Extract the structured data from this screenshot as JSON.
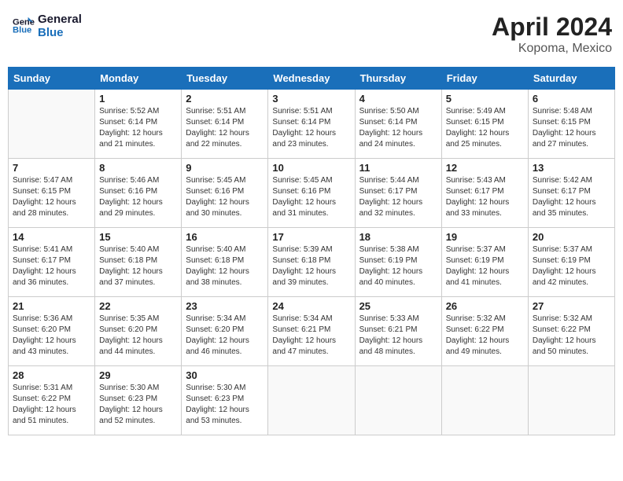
{
  "header": {
    "logo_line1": "General",
    "logo_line2": "Blue",
    "month_year": "April 2024",
    "location": "Kopoma, Mexico"
  },
  "weekdays": [
    "Sunday",
    "Monday",
    "Tuesday",
    "Wednesday",
    "Thursday",
    "Friday",
    "Saturday"
  ],
  "weeks": [
    [
      {
        "day": "",
        "info": ""
      },
      {
        "day": "1",
        "info": "Sunrise: 5:52 AM\nSunset: 6:14 PM\nDaylight: 12 hours\nand 21 minutes."
      },
      {
        "day": "2",
        "info": "Sunrise: 5:51 AM\nSunset: 6:14 PM\nDaylight: 12 hours\nand 22 minutes."
      },
      {
        "day": "3",
        "info": "Sunrise: 5:51 AM\nSunset: 6:14 PM\nDaylight: 12 hours\nand 23 minutes."
      },
      {
        "day": "4",
        "info": "Sunrise: 5:50 AM\nSunset: 6:14 PM\nDaylight: 12 hours\nand 24 minutes."
      },
      {
        "day": "5",
        "info": "Sunrise: 5:49 AM\nSunset: 6:15 PM\nDaylight: 12 hours\nand 25 minutes."
      },
      {
        "day": "6",
        "info": "Sunrise: 5:48 AM\nSunset: 6:15 PM\nDaylight: 12 hours\nand 27 minutes."
      }
    ],
    [
      {
        "day": "7",
        "info": "Sunrise: 5:47 AM\nSunset: 6:15 PM\nDaylight: 12 hours\nand 28 minutes."
      },
      {
        "day": "8",
        "info": "Sunrise: 5:46 AM\nSunset: 6:16 PM\nDaylight: 12 hours\nand 29 minutes."
      },
      {
        "day": "9",
        "info": "Sunrise: 5:45 AM\nSunset: 6:16 PM\nDaylight: 12 hours\nand 30 minutes."
      },
      {
        "day": "10",
        "info": "Sunrise: 5:45 AM\nSunset: 6:16 PM\nDaylight: 12 hours\nand 31 minutes."
      },
      {
        "day": "11",
        "info": "Sunrise: 5:44 AM\nSunset: 6:17 PM\nDaylight: 12 hours\nand 32 minutes."
      },
      {
        "day": "12",
        "info": "Sunrise: 5:43 AM\nSunset: 6:17 PM\nDaylight: 12 hours\nand 33 minutes."
      },
      {
        "day": "13",
        "info": "Sunrise: 5:42 AM\nSunset: 6:17 PM\nDaylight: 12 hours\nand 35 minutes."
      }
    ],
    [
      {
        "day": "14",
        "info": "Sunrise: 5:41 AM\nSunset: 6:17 PM\nDaylight: 12 hours\nand 36 minutes."
      },
      {
        "day": "15",
        "info": "Sunrise: 5:40 AM\nSunset: 6:18 PM\nDaylight: 12 hours\nand 37 minutes."
      },
      {
        "day": "16",
        "info": "Sunrise: 5:40 AM\nSunset: 6:18 PM\nDaylight: 12 hours\nand 38 minutes."
      },
      {
        "day": "17",
        "info": "Sunrise: 5:39 AM\nSunset: 6:18 PM\nDaylight: 12 hours\nand 39 minutes."
      },
      {
        "day": "18",
        "info": "Sunrise: 5:38 AM\nSunset: 6:19 PM\nDaylight: 12 hours\nand 40 minutes."
      },
      {
        "day": "19",
        "info": "Sunrise: 5:37 AM\nSunset: 6:19 PM\nDaylight: 12 hours\nand 41 minutes."
      },
      {
        "day": "20",
        "info": "Sunrise: 5:37 AM\nSunset: 6:19 PM\nDaylight: 12 hours\nand 42 minutes."
      }
    ],
    [
      {
        "day": "21",
        "info": "Sunrise: 5:36 AM\nSunset: 6:20 PM\nDaylight: 12 hours\nand 43 minutes."
      },
      {
        "day": "22",
        "info": "Sunrise: 5:35 AM\nSunset: 6:20 PM\nDaylight: 12 hours\nand 44 minutes."
      },
      {
        "day": "23",
        "info": "Sunrise: 5:34 AM\nSunset: 6:20 PM\nDaylight: 12 hours\nand 46 minutes."
      },
      {
        "day": "24",
        "info": "Sunrise: 5:34 AM\nSunset: 6:21 PM\nDaylight: 12 hours\nand 47 minutes."
      },
      {
        "day": "25",
        "info": "Sunrise: 5:33 AM\nSunset: 6:21 PM\nDaylight: 12 hours\nand 48 minutes."
      },
      {
        "day": "26",
        "info": "Sunrise: 5:32 AM\nSunset: 6:22 PM\nDaylight: 12 hours\nand 49 minutes."
      },
      {
        "day": "27",
        "info": "Sunrise: 5:32 AM\nSunset: 6:22 PM\nDaylight: 12 hours\nand 50 minutes."
      }
    ],
    [
      {
        "day": "28",
        "info": "Sunrise: 5:31 AM\nSunset: 6:22 PM\nDaylight: 12 hours\nand 51 minutes."
      },
      {
        "day": "29",
        "info": "Sunrise: 5:30 AM\nSunset: 6:23 PM\nDaylight: 12 hours\nand 52 minutes."
      },
      {
        "day": "30",
        "info": "Sunrise: 5:30 AM\nSunset: 6:23 PM\nDaylight: 12 hours\nand 53 minutes."
      },
      {
        "day": "",
        "info": ""
      },
      {
        "day": "",
        "info": ""
      },
      {
        "day": "",
        "info": ""
      },
      {
        "day": "",
        "info": ""
      }
    ]
  ]
}
